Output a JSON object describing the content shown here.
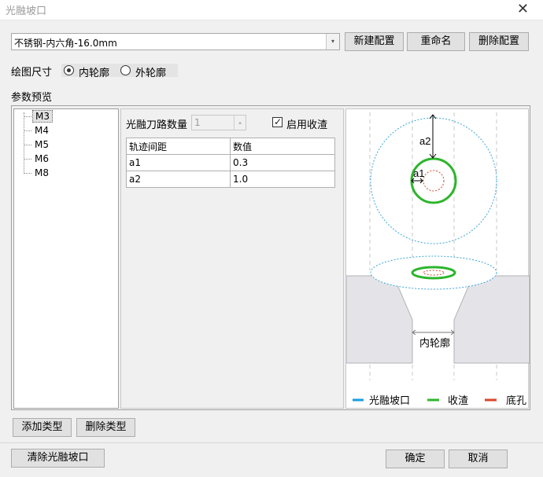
{
  "window": {
    "title": "光融坡口",
    "close_glyph": "✕"
  },
  "config": {
    "selected": "不锈钢-内六角-16.0mm",
    "dropdown_glyph": "▾",
    "buttons": {
      "new": "新建配置",
      "rename": "重命名",
      "delete": "删除配置"
    }
  },
  "draw_size": {
    "label": "绘图尺寸",
    "options": [
      {
        "label": "内轮廓",
        "checked": true
      },
      {
        "label": "外轮廓",
        "checked": false
      }
    ]
  },
  "param_preview_label": "参数预览",
  "tree": {
    "items": [
      "M3",
      "M4",
      "M5",
      "M6",
      "M8"
    ],
    "selected_index": 0
  },
  "params": {
    "path_count_label": "光融刀路数量",
    "path_count_value": "1",
    "spin_glyph": "▴",
    "enable_slag_label": "启用收渣",
    "enable_slag_checked": true,
    "check_glyph": "✓",
    "table": {
      "headers": [
        "轨迹间距",
        "数值"
      ],
      "rows": [
        [
          "a1",
          "0.3"
        ],
        [
          "a2",
          "1.0"
        ]
      ]
    }
  },
  "preview": {
    "a2_label": "a2",
    "a1_label": "a1",
    "inner_profile_label": "内轮廓",
    "legend": [
      {
        "label": "光融坡口",
        "color": "#1a9de0"
      },
      {
        "label": "收渣",
        "color": "#2db52d"
      },
      {
        "label": "底孔",
        "color": "#d9462b"
      }
    ]
  },
  "footer": {
    "add_type": "添加类型",
    "delete_type": "删除类型",
    "clear": "清除光融坡口",
    "ok": "确定",
    "cancel": "取消"
  }
}
